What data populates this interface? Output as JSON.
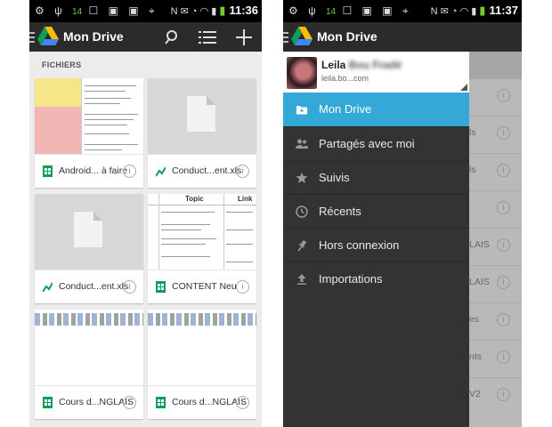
{
  "left_screen": {
    "status": {
      "time": "11:36",
      "notif_count": "14"
    },
    "app_title": "Mon Drive",
    "section_title": "FICHIERS",
    "files": [
      {
        "name": "Android... à faire",
        "type": "sheets-doc-icon"
      },
      {
        "name": "Conduct...ent.xls",
        "type": "excel-chart-icon"
      },
      {
        "name": "Conduct...ent.xls",
        "type": "excel-chart-icon"
      },
      {
        "name": "CONTENT Neu",
        "type": "sheets-doc-icon"
      },
      {
        "name": "Cours d...NGLAIS",
        "type": "sheets-doc-icon"
      },
      {
        "name": "Cours d...NGLAIS",
        "type": "sheets-doc-icon"
      }
    ],
    "thumb_headers": [
      "Topic",
      "Link"
    ]
  },
  "right_screen": {
    "status": {
      "time": "11:37",
      "notif_count": "14"
    },
    "app_title": "Mon Drive",
    "account": {
      "name": "Leila",
      "email": "leila.bo...com"
    },
    "drawer_items": [
      {
        "label": "Mon Drive",
        "icon": "drive-folder-icon",
        "active": true
      },
      {
        "label": "Partagés avec moi",
        "icon": "people-icon",
        "active": false
      },
      {
        "label": "Suivis",
        "icon": "star-icon",
        "active": false
      },
      {
        "label": "Récents",
        "icon": "clock-icon",
        "active": false
      },
      {
        "label": "Hors connexion",
        "icon": "pin-icon",
        "active": false
      },
      {
        "label": "Importations",
        "icon": "upload-icon",
        "active": false
      }
    ],
    "behind_fragments": [
      "ls",
      "ls",
      "LAIS",
      "LAIS",
      "es",
      "nts",
      "V2"
    ]
  },
  "colors": {
    "accent_blue": "#34a8d6",
    "appbar": "#2b2b2b",
    "drawer": "#333333",
    "sheets_green": "#0f9d58"
  }
}
